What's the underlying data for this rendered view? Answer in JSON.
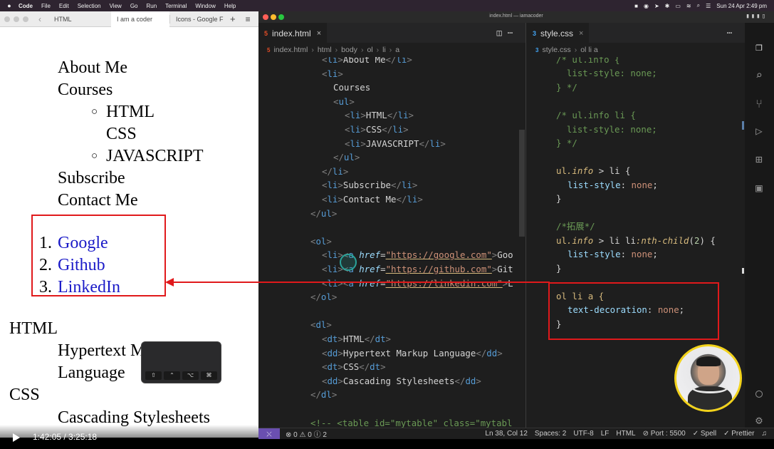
{
  "menubar": {
    "app_name": "Code",
    "items": [
      "File",
      "Edit",
      "Selection",
      "View",
      "Go",
      "Run",
      "Terminal",
      "Window",
      "Help"
    ],
    "datetime": "Sun 24 Apr  2:49 pm"
  },
  "browser": {
    "tabs": [
      "HTML",
      "I am a coder",
      "Icons - Google F"
    ],
    "page": {
      "menu_items": [
        "About Me",
        "Courses"
      ],
      "sub_items": [
        "HTML",
        "CSS",
        "JAVASCRIPT"
      ],
      "menu_items_after": [
        "Subscribe",
        "Contact Me"
      ],
      "ordered": [
        {
          "num": "1.",
          "text": "Google"
        },
        {
          "num": "2.",
          "text": "Github"
        },
        {
          "num": "3.",
          "text": "LinkedIn"
        }
      ],
      "definitions": [
        {
          "term": "HTML",
          "desc_line1": "Hypertext Markup",
          "desc_line2": "Language"
        },
        {
          "term": "CSS",
          "desc_line1": "Cascading Stylesheets"
        }
      ]
    },
    "keypad_keys": [
      "⇧",
      "⌃",
      "⌥",
      "⌘"
    ]
  },
  "video": {
    "time": "1:42:05 / 3:25:18"
  },
  "vscode": {
    "window_title": "index.html — iamacoder",
    "left_tab": "index.html",
    "right_tab": "style.css",
    "left_crumbs": [
      "index.html",
      "html",
      "body",
      "ol",
      "li",
      "a"
    ],
    "right_crumbs": [
      "style.css",
      "ol li a"
    ],
    "html_lines": [
      "<li>About Me</li>",
      "<li>",
      "Courses",
      "<ul>",
      "<li>HTML</li>",
      "<li>CSS</li>",
      "<li>JAVASCRIPT</li>",
      "</ul>",
      "</li>",
      "<li>Subscribe</li>",
      "<li>Contact Me</li>",
      "</ul>",
      "",
      "<ol>",
      "<li><a href=\"https://google.com\">Goo",
      "<li><a href=\"https://github.com\">Git",
      "<li><a href=\"https://linkedin.com\">L",
      "</ol>",
      "",
      "<dl>",
      "<dt>HTML</dt>",
      "<dd>Hypertext Markup Language</dd>",
      "<dt>CSS</dt>",
      "<dd>Cascading Stylesheets</dd>",
      "</dl>",
      "",
      "<!-- <table id=\"mytable\" class=\"mytabl"
    ],
    "css_lines": {
      "c1a": "/* ul.info {",
      "c1b": "  list-style: none;",
      "c1c": "} */",
      "c2a": "/* ul.info li {",
      "c2b": "  list-style: none;",
      "c2c": "} */",
      "r1_sel_a": "ul",
      "r1_sel_b": ".info",
      "r1_sel_c": " > li {",
      "prop": "list-style",
      "none": "none",
      "close": "}",
      "comment_ext": "/*拓展*/",
      "r2_sel_c": " > li li",
      "r2_pseudo": ":nth-child",
      "r2_num": "2",
      "r3_sel": "ol li a {",
      "r3_prop": "text-decoration",
      "r3_val": "none"
    },
    "status": {
      "problems": "⊗ 0 ⚠ 0 ⓘ 2",
      "position": "Ln 38, Col 12",
      "spaces": "Spaces: 2",
      "encoding": "UTF-8",
      "eol": "LF",
      "language": "HTML",
      "port": "⊘ Port : 5500",
      "spell": "✓ Spell",
      "prettier": "✓ Prettier"
    }
  }
}
